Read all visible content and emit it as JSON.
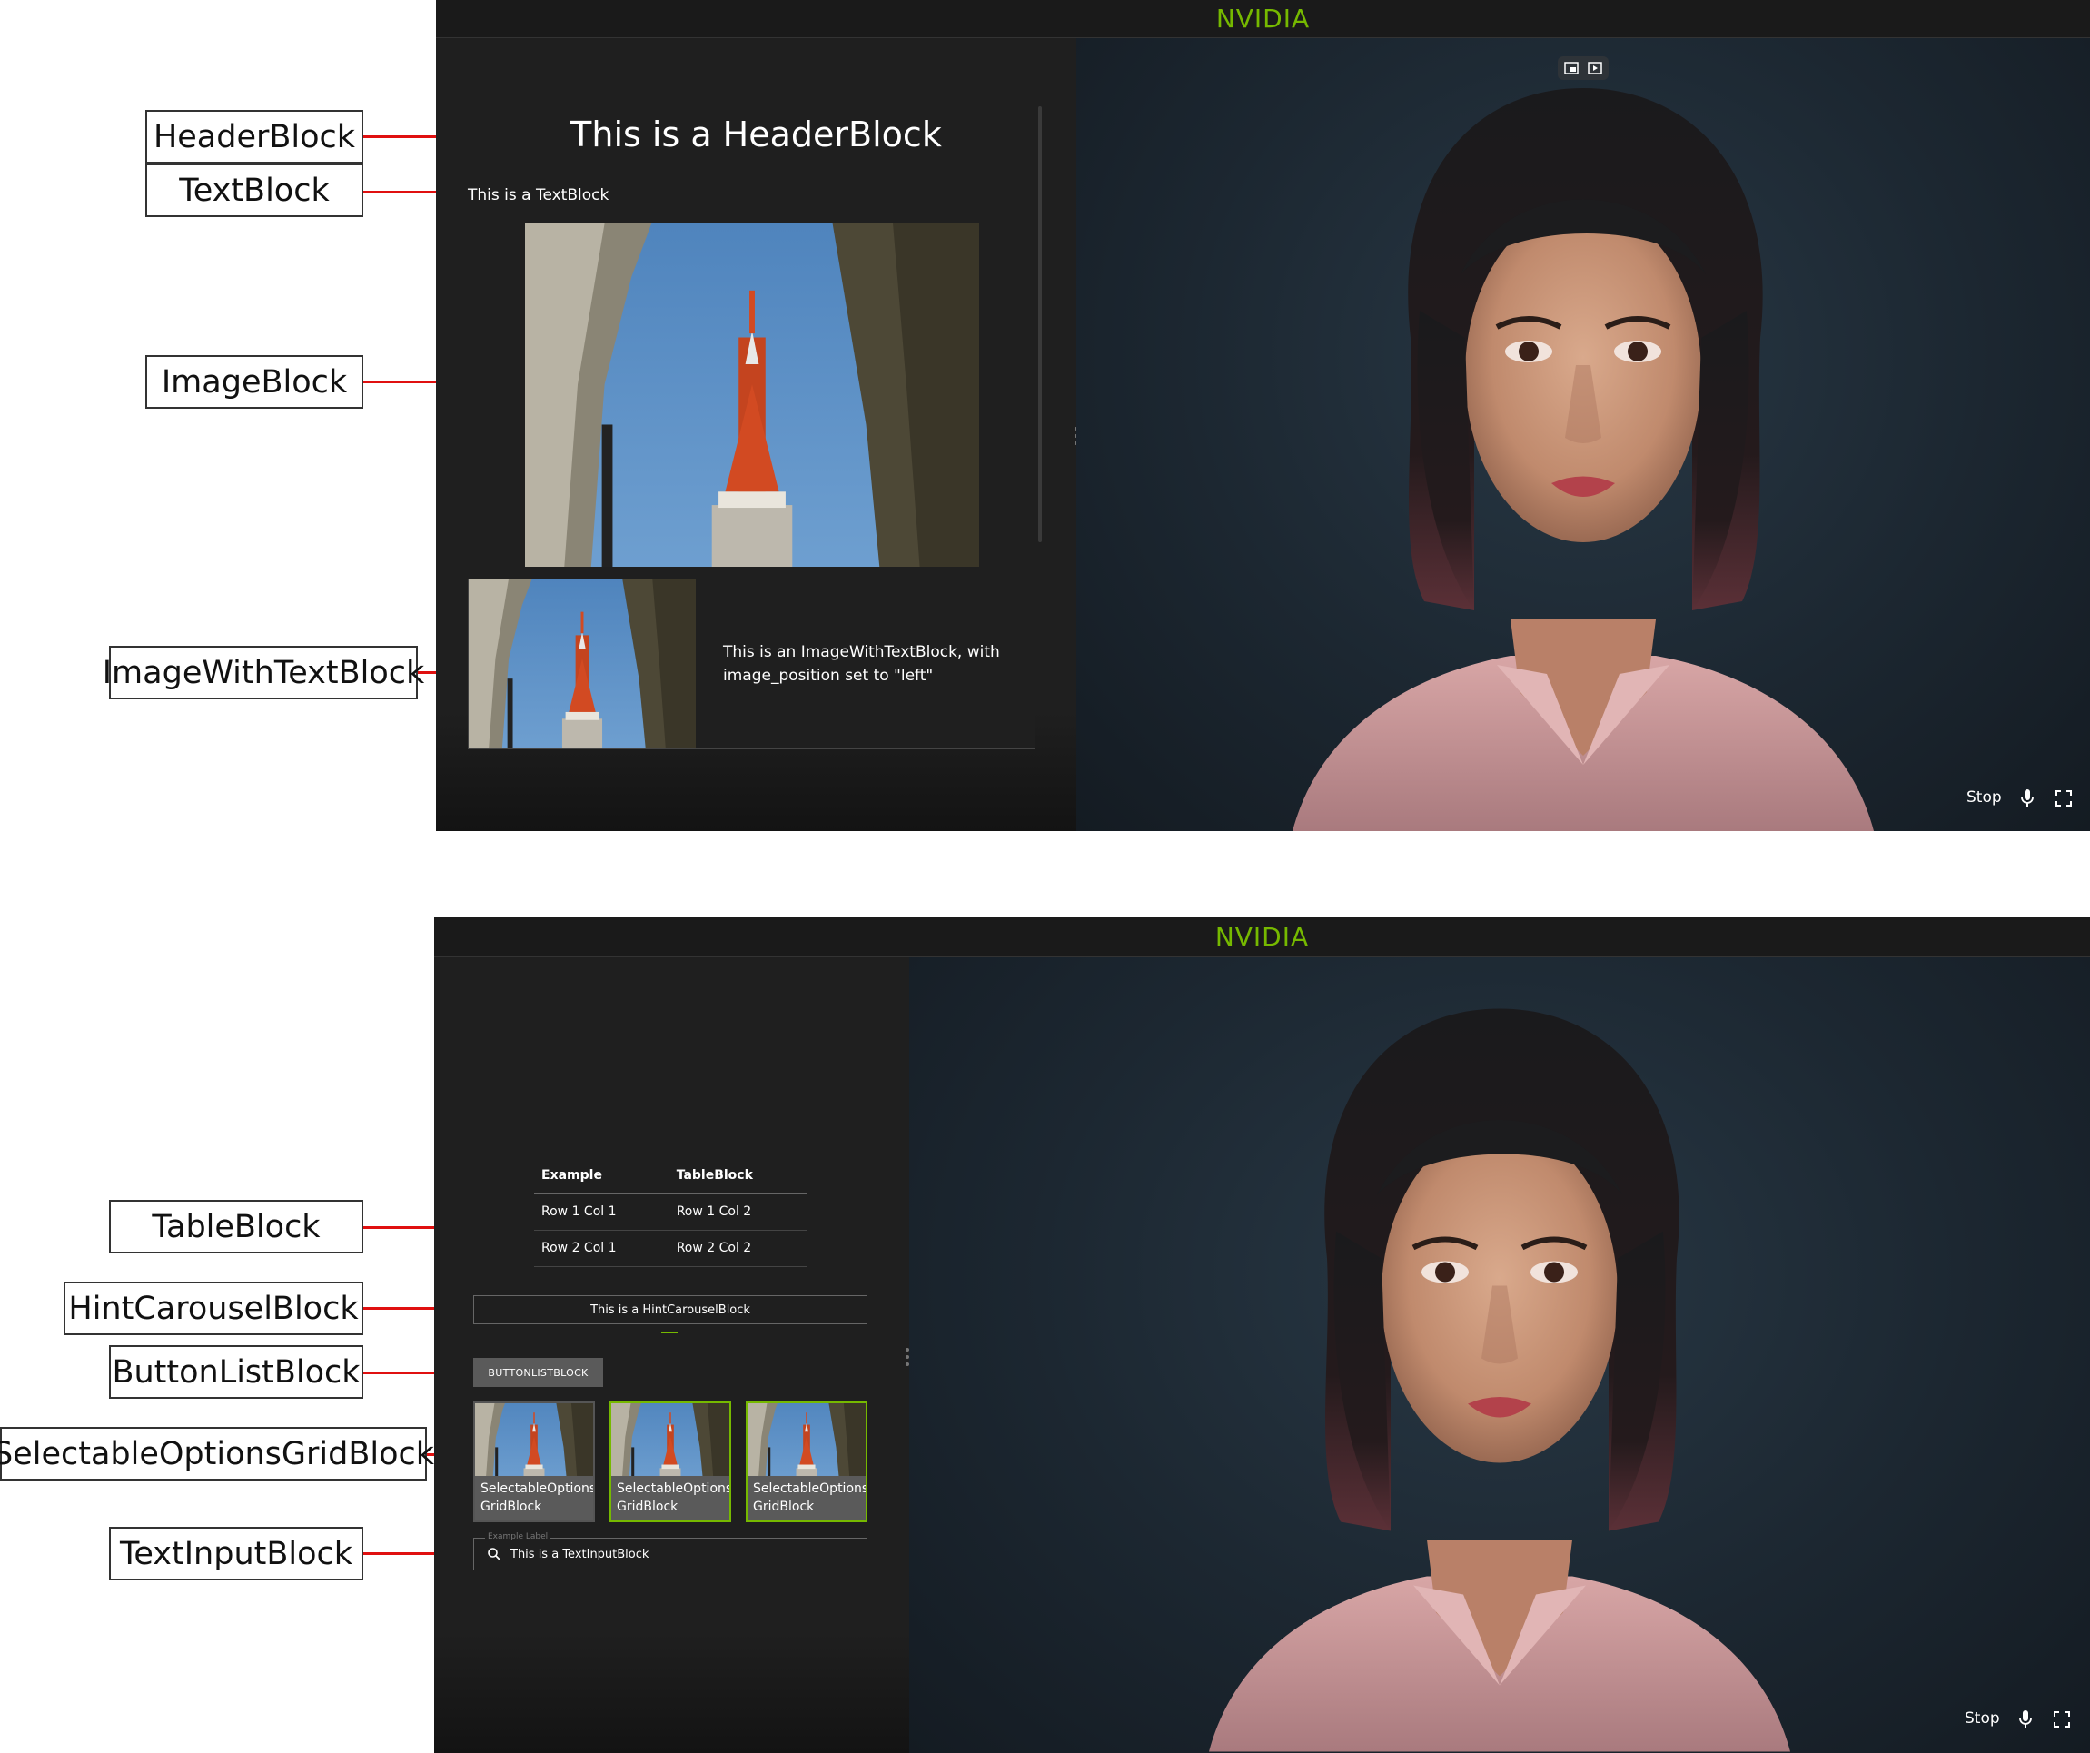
{
  "callouts": {
    "header_block": "HeaderBlock",
    "text_block": "TextBlock",
    "image_block": "ImageBlock",
    "image_with_text_block": "ImageWithTextBlock",
    "table_block": "TableBlock",
    "hint_carousel_block": "HintCarouselBlock",
    "button_list_block": "ButtonListBlock",
    "selectable_options_grid_block": "SelectableOptionsGridBlock",
    "text_input_block": "TextInputBlock"
  },
  "app": {
    "brand": "NVIDIA",
    "brand_color": "#76b900"
  },
  "controls": {
    "stop_label": "Stop",
    "mic_icon": "microphone-icon",
    "fullscreen_icon": "fullscreen-icon",
    "top_icons": [
      "picture-in-picture-icon",
      "play-video-icon"
    ]
  },
  "panel1": {
    "header": "This is a HeaderBlock",
    "text": "This is a TextBlock",
    "image_with_text": "This is an ImageWithTextBlock, with image_position set to \"left\""
  },
  "panel2": {
    "table": {
      "headers": [
        "Example",
        "TableBlock"
      ],
      "rows": [
        [
          "Row 1 Col 1",
          "Row 1 Col 2"
        ],
        [
          "Row 2 Col 1",
          "Row 2 Col 2"
        ]
      ]
    },
    "hint_carousel": "This is a HintCarouselBlock",
    "button_label": "BUTTONLISTBLOCK",
    "options": [
      {
        "line1": "SelectableOptions-",
        "line2": "GridBlock",
        "selected": false
      },
      {
        "line1": "SelectableOptions-",
        "line2": "GridBlock",
        "selected": true
      },
      {
        "line1": "SelectableOptions-",
        "line2": "GridBlock",
        "selected": true
      }
    ],
    "input_label": "Example Label",
    "input_value": "This is a TextInputBlock",
    "search_icon": "search-icon"
  }
}
